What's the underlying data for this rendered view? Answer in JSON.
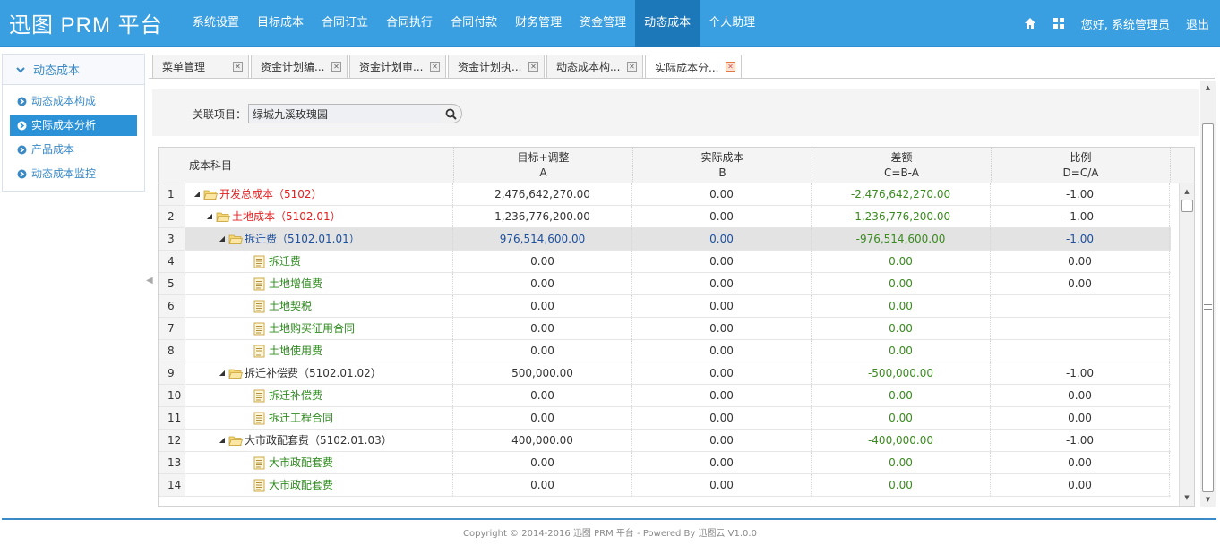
{
  "app": {
    "title": "迅图 PRM 平台"
  },
  "nav": {
    "items": [
      "系统设置",
      "目标成本",
      "合同订立",
      "合同执行",
      "合同付款",
      "财务管理",
      "资金管理",
      "动态成本",
      "个人助理"
    ],
    "active_index": 7
  },
  "header_right": {
    "home_icon": "home-icon",
    "grid_icon": "apps-grid-icon",
    "greeting": "您好, 系统管理员",
    "logout": "退出"
  },
  "sidebar": {
    "title": "动态成本",
    "items": [
      {
        "label": "动态成本构成",
        "active": false
      },
      {
        "label": "实际成本分析",
        "active": true
      },
      {
        "label": "产品成本",
        "active": false
      },
      {
        "label": "动态成本监控",
        "active": false
      }
    ]
  },
  "tabs": [
    {
      "label": "菜单管理",
      "active": false
    },
    {
      "label": "资金计划编...",
      "active": false
    },
    {
      "label": "资金计划审...",
      "active": false
    },
    {
      "label": "资金计划执...",
      "active": false
    },
    {
      "label": "动态成本构...",
      "active": false
    },
    {
      "label": "实际成本分...",
      "active": true
    }
  ],
  "filter": {
    "label": "关联项目：",
    "value": "绿城九溪玫瑰园",
    "search_icon": "search-icon"
  },
  "grid": {
    "columns": [
      {
        "title": "成本科目",
        "sub": ""
      },
      {
        "title": "目标+调整",
        "sub": "A"
      },
      {
        "title": "实际成本",
        "sub": "B"
      },
      {
        "title": "差额",
        "sub": "C=B-A"
      },
      {
        "title": "比例",
        "sub": "D=C/A"
      }
    ],
    "rows": [
      {
        "no": "1",
        "level": 0,
        "type": "folder",
        "name": "开发总成本（5102）",
        "color": "red",
        "a": "2,476,642,270.00",
        "b": "0.00",
        "c": "-2,476,642,270.00",
        "d": "-1.00"
      },
      {
        "no": "2",
        "level": 1,
        "type": "folder",
        "name": "土地成本（5102.01）",
        "color": "red",
        "a": "1,236,776,200.00",
        "b": "0.00",
        "c": "-1,236,776,200.00",
        "d": "-1.00"
      },
      {
        "no": "3",
        "level": 2,
        "type": "folder",
        "name": "拆迁费（5102.01.01）",
        "color": "blue",
        "a": "976,514,600.00",
        "b": "0.00",
        "c": "-976,514,600.00",
        "d": "-1.00",
        "selected": true
      },
      {
        "no": "4",
        "level": 3,
        "type": "leaf",
        "name": "拆迁费",
        "color": "green",
        "a": "0.00",
        "b": "0.00",
        "c": "0.00",
        "d": "0.00"
      },
      {
        "no": "5",
        "level": 3,
        "type": "leaf",
        "name": "土地增值费",
        "color": "green",
        "a": "0.00",
        "b": "0.00",
        "c": "0.00",
        "d": "0.00"
      },
      {
        "no": "6",
        "level": 3,
        "type": "leaf",
        "name": "土地契税",
        "color": "green",
        "a": "0.00",
        "b": "0.00",
        "c": "0.00",
        "d": ""
      },
      {
        "no": "7",
        "level": 3,
        "type": "leaf",
        "name": "土地购买征用合同",
        "color": "green",
        "a": "0.00",
        "b": "0.00",
        "c": "0.00",
        "d": ""
      },
      {
        "no": "8",
        "level": 3,
        "type": "leaf",
        "name": "土地使用费",
        "color": "green",
        "a": "0.00",
        "b": "0.00",
        "c": "0.00",
        "d": ""
      },
      {
        "no": "9",
        "level": 2,
        "type": "folder",
        "name": "拆迁补偿费（5102.01.02）",
        "color": "black",
        "a": "500,000.00",
        "b": "0.00",
        "c": "-500,000.00",
        "d": "-1.00"
      },
      {
        "no": "10",
        "level": 3,
        "type": "leaf",
        "name": "拆迁补偿费",
        "color": "green",
        "a": "0.00",
        "b": "0.00",
        "c": "0.00",
        "d": "0.00"
      },
      {
        "no": "11",
        "level": 3,
        "type": "leaf",
        "name": "拆迁工程合同",
        "color": "green",
        "a": "0.00",
        "b": "0.00",
        "c": "0.00",
        "d": "0.00"
      },
      {
        "no": "12",
        "level": 2,
        "type": "folder",
        "name": "大市政配套费（5102.01.03）",
        "color": "black",
        "a": "400,000.00",
        "b": "0.00",
        "c": "-400,000.00",
        "d": "-1.00"
      },
      {
        "no": "13",
        "level": 3,
        "type": "leaf",
        "name": "大市政配套费",
        "color": "green",
        "a": "0.00",
        "b": "0.00",
        "c": "0.00",
        "d": "0.00"
      },
      {
        "no": "14",
        "level": 3,
        "type": "leaf",
        "name": "大市政配套费",
        "color": "green",
        "a": "0.00",
        "b": "0.00",
        "c": "0.00",
        "d": "0.00"
      }
    ]
  },
  "footer": {
    "text": "Copyright © 2014-2016 迅图 PRM 平台 - Powered By 迅图云 V1.0.0"
  },
  "colors": {
    "header": "#3a9fe0",
    "nav_active": "#1d78ba",
    "sidebar_active": "#2b92d8",
    "red": "#e02020",
    "blue": "#1d4f9c",
    "green": "#2e8b1e"
  }
}
